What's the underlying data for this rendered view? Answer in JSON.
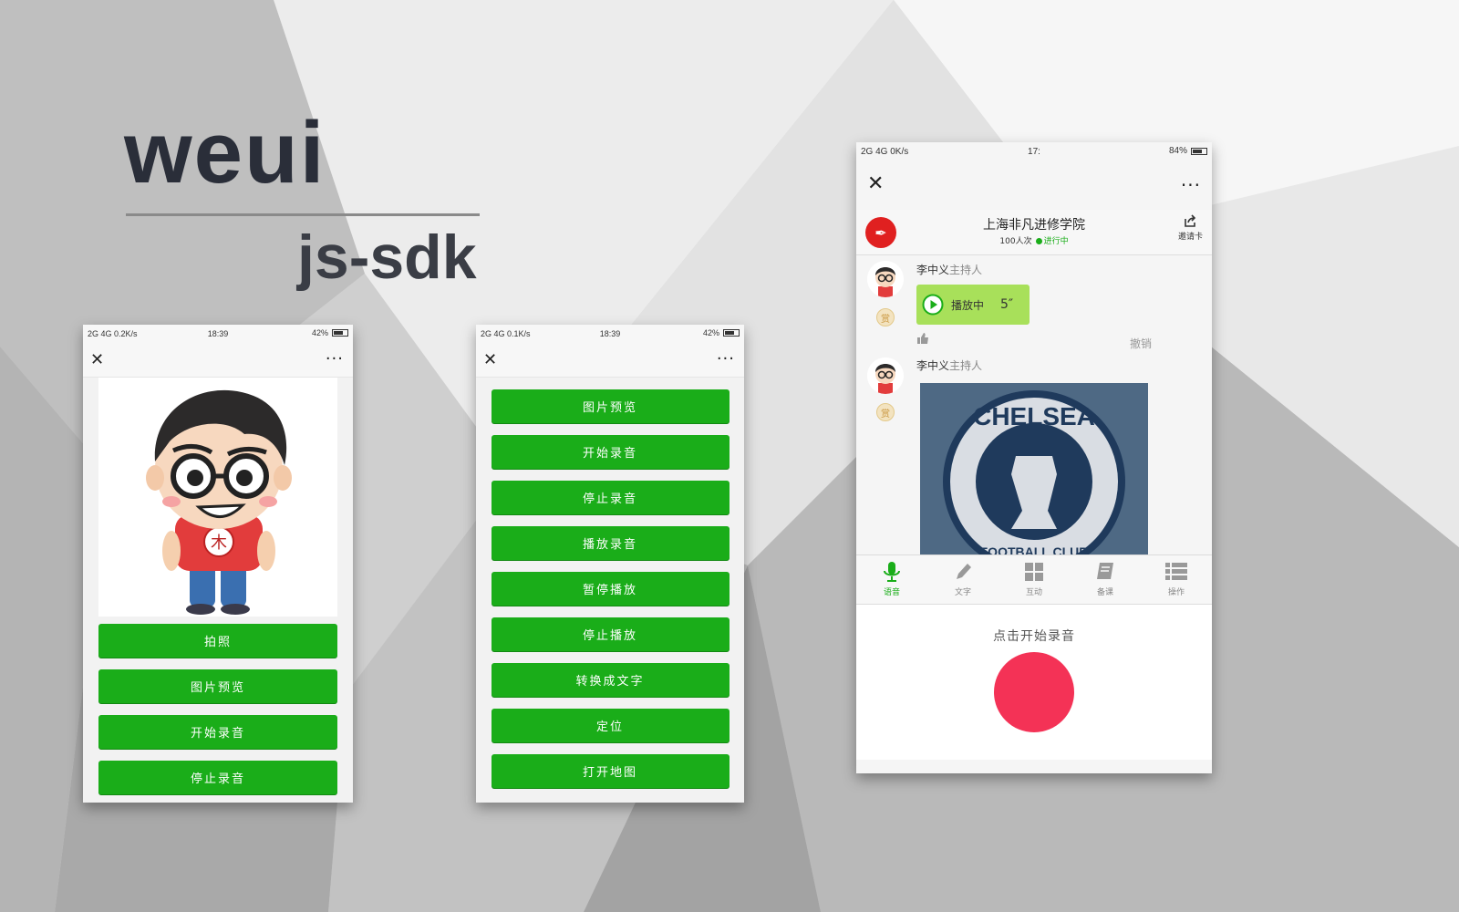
{
  "banner": {
    "title": "weui",
    "subtitle": "js-sdk"
  },
  "phone1": {
    "status": {
      "network": "2G 4G",
      "speed": "0.2K/s",
      "time": "18:39",
      "battery": "42%"
    },
    "nav": {
      "close": "✕",
      "more": "···"
    },
    "image_icon": "cartoon-avatar",
    "buttons": [
      "拍照",
      "图片预览",
      "开始录音",
      "停止录音"
    ]
  },
  "phone2": {
    "status": {
      "network": "2G 4G",
      "speed": "0.1K/s",
      "time": "18:39",
      "battery": "42%"
    },
    "nav": {
      "close": "✕",
      "more": "···"
    },
    "buttons": [
      "图片预览",
      "开始录音",
      "停止录音",
      "播放录音",
      "暂停播放",
      "停止播放",
      "转换成文字",
      "定位",
      "打开地图"
    ]
  },
  "phone3": {
    "status": {
      "network": "2G 4G",
      "speed": "0K/s",
      "time": "17:",
      "battery": "84%"
    },
    "nav": {
      "close": "✕",
      "more": "···"
    },
    "room": {
      "title": "上海非凡进修学院",
      "views": "100人次",
      "state": "进行中",
      "invite": "邀请卡"
    },
    "messages": [
      {
        "name": "李中义",
        "role": "主持人",
        "reward": "赏",
        "voice_state": "播放中",
        "duration": "5″",
        "revoke": "撤销"
      },
      {
        "name": "李中义",
        "role": "主持人",
        "reward": "赏",
        "image_icon": "chelsea-badge"
      }
    ],
    "chelsea_text": {
      "top": "CHELSEA",
      "bottom": "FOOTBALL CLUB"
    },
    "tabs": [
      {
        "label": "语音",
        "icon": "microphone-icon",
        "active": true
      },
      {
        "label": "文字",
        "icon": "pencil-icon",
        "active": false
      },
      {
        "label": "互动",
        "icon": "grid-icon",
        "active": false
      },
      {
        "label": "备课",
        "icon": "book-icon",
        "active": false
      },
      {
        "label": "操作",
        "icon": "list-icon",
        "active": false
      }
    ],
    "record_hint": "点击开始录音"
  },
  "colors": {
    "button_green": "#1aad19",
    "voice_bubble": "#a8e05a",
    "record_red": "#f43256",
    "title_dark": "#2a2e39"
  }
}
